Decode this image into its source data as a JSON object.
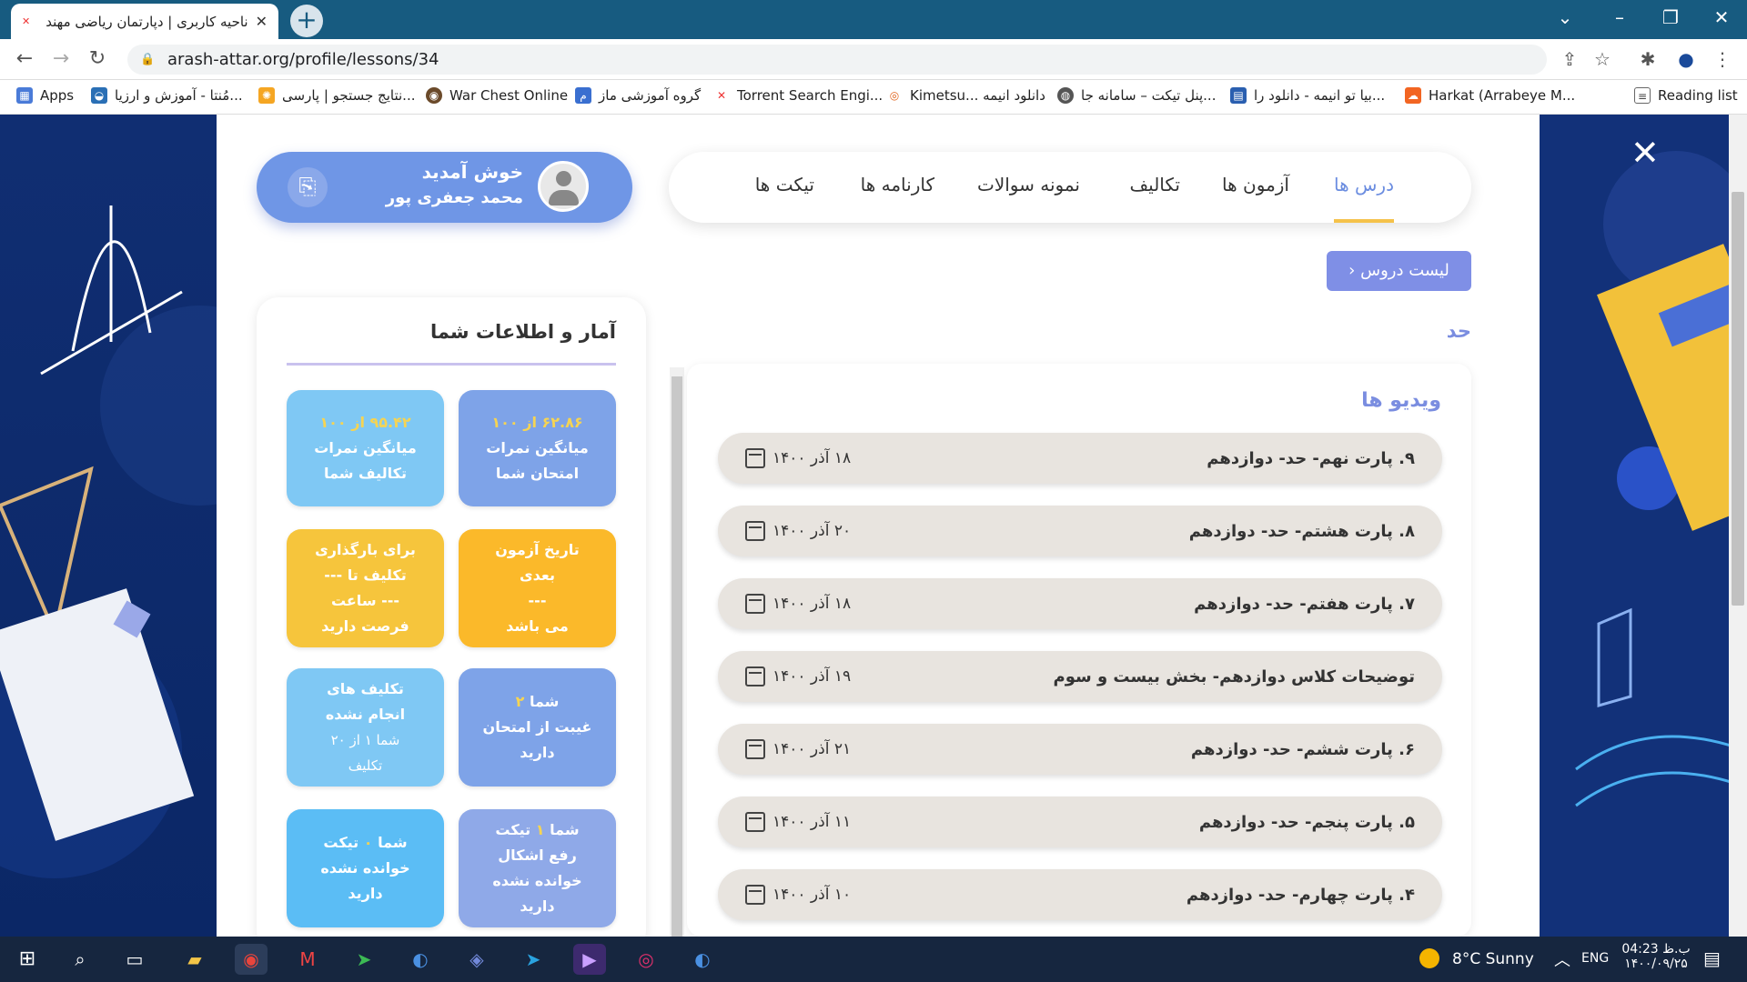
{
  "browser": {
    "tab_title": "ناحیه کاربری | دپارتمان ریاضی مهندس",
    "url": "arash-attar.org/profile/lessons/34",
    "bookmarks": [
      {
        "label": "Apps",
        "icon": "apps-icon"
      },
      {
        "label": "مُنتا - آموزش و ارزیا...",
        "icon": "monta-icon"
      },
      {
        "label": "نتایج جستجو | پارسی...",
        "icon": "sun-icon"
      },
      {
        "label": "War Chest Online",
        "icon": "warchest-icon"
      },
      {
        "label": "گروه آموزشی ماز",
        "icon": "maz-icon"
      },
      {
        "label": "Torrent Search Engi...",
        "icon": "torrent-icon"
      },
      {
        "label": "Kimetsu... دانلود انیمه",
        "icon": "kimetsu-icon"
      },
      {
        "label": "پنل تیکت – سامانه جا...",
        "icon": "globe-icon"
      },
      {
        "label": "بیا تو انیمه - دانلود را...",
        "icon": "anime-icon"
      },
      {
        "label": "Harkat (Arrabeye M...",
        "icon": "soundcloud-icon"
      },
      {
        "label": "Reading list",
        "icon": "reading-list-icon"
      }
    ]
  },
  "user": {
    "welcome": "خوش آمدید",
    "name": "محمد جعفری پور"
  },
  "nav": {
    "tabs": [
      "درس ها",
      "آزمون ها",
      "تکالیف",
      "نمونه سوالات",
      "کارنامه ها",
      "تیکت ها"
    ],
    "active": "درس ها"
  },
  "lessons": {
    "list_button": "لیست دروس",
    "topic": "حد",
    "videos_heading": "ویدیو ها",
    "videos": [
      {
        "title": "۹. پارت نهم- حد- دوازدهم",
        "date": "۱۸ آذر ۱۴۰۰"
      },
      {
        "title": "۸. پارت هشتم- حد- دوازدهم",
        "date": "۲۰ آذر ۱۴۰۰"
      },
      {
        "title": "۷. پارت هفتم- حد- دوازدهم",
        "date": "۱۸ آذر ۱۴۰۰"
      },
      {
        "title": "توضیحات کلاس دوازدهم- بخش بیست و سوم",
        "date": "۱۹ آذر ۱۴۰۰"
      },
      {
        "title": "۶. پارت ششم- حد- دوازدهم",
        "date": "۲۱ آذر ۱۴۰۰"
      },
      {
        "title": "۵. پارت پنجم- حد- دوازدهم",
        "date": "۱۱ آذر ۱۴۰۰"
      },
      {
        "title": "۴. پارت چهارم- حد- دوازدهم",
        "date": "۱۰ آذر ۱۴۰۰"
      }
    ]
  },
  "stats": {
    "heading": "آمار و اطلاعات شما",
    "exam_avg": {
      "value": "۶۲.۸۶",
      "of": "از ۱۰۰",
      "line1": "میانگین نمرات",
      "line2": "امتحان شما",
      "color": "#7ea3e8"
    },
    "hw_avg": {
      "value": "۹۵.۴۲",
      "of": "از ۱۰۰",
      "line1": "میانگین نمرات",
      "line2": "تکالیف شما",
      "color": "#7fc8f4"
    },
    "next_exam": {
      "line1": "تاریخ آزمون",
      "line2": "بعدی",
      "line3": "---",
      "line4": "می باشد",
      "color": "#fbb92a"
    },
    "upload": {
      "line1": "برای بارگذاری",
      "line2": "تکلیف تا ---",
      "line3": "--- ساعت",
      "line4": "فرصت دارید",
      "color": "#f6c53c"
    },
    "absence": {
      "pre": "شما",
      "value": "۲",
      "line2": "غیبت از امتحان",
      "line3": "دارید",
      "color": "#7ea3e8"
    },
    "undone_hw": {
      "line1": "تکلیف های",
      "line2": "انجام نشده",
      "line3": "شما ۱ از ۲۰",
      "line4": "تکلیف",
      "color": "#7fc8f4"
    },
    "unread_tickets_1": {
      "pre": "شما",
      "value": "۱",
      "post": "تیکت",
      "line2": "رفع اشکال",
      "line3": "خوانده نشده",
      "line4": "دارید",
      "color": "#8fa9e8"
    },
    "unread_tickets_0": {
      "pre": "شما",
      "value": "۰",
      "post": "تیکت",
      "line2": "خوانده نشده",
      "line3": "دارید",
      "color": "#5bbdf5"
    }
  },
  "taskbar": {
    "weather": "8°C  Sunny",
    "lang": "ENG",
    "time": "04:23 ب.ظ",
    "date": "۱۴۰۰/۰۹/۲۵"
  }
}
